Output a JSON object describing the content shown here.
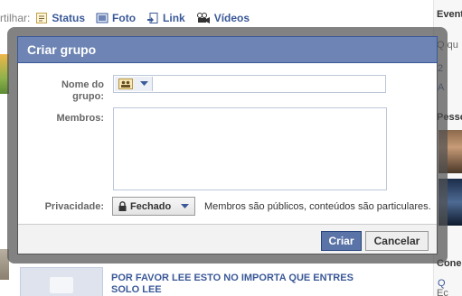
{
  "background": {
    "share_label": "rtilhar:",
    "share_items": [
      "Status",
      "Foto",
      "Link",
      "Vídeos"
    ],
    "right_column": {
      "events_heading": "Event",
      "search_placeholder": "Q qu",
      "item1": "2",
      "item2": "A",
      "people_heading": "Pesso",
      "connections_heading": "Cone",
      "item3": "Q",
      "item4": "Ec"
    },
    "post_title": "POR FAVOR LEE ESTO NO IMPORTA QUE ENTRES SOLO LEE"
  },
  "dialog": {
    "title": "Criar grupo",
    "fields": {
      "name_label": "Nome do grupo:",
      "name_value": "",
      "members_label": "Membros:",
      "members_value": "",
      "privacy_label": "Privacidade:",
      "privacy_value": "Fechado",
      "privacy_description": "Membros são públicos, conteúdos são particulares."
    },
    "buttons": {
      "create": "Criar",
      "cancel": "Cancelar"
    }
  },
  "colors": {
    "brand_blue": "#3b5998",
    "header_blue": "#6d84b4",
    "primary_button": "#5b74a8"
  },
  "icons": {
    "status": "status-icon",
    "photo": "photo-icon",
    "link": "link-icon",
    "video": "video-icon",
    "group_icon_picker": "group-icon",
    "privacy": "lock-icon",
    "dropdown": "chevron-down-icon"
  }
}
